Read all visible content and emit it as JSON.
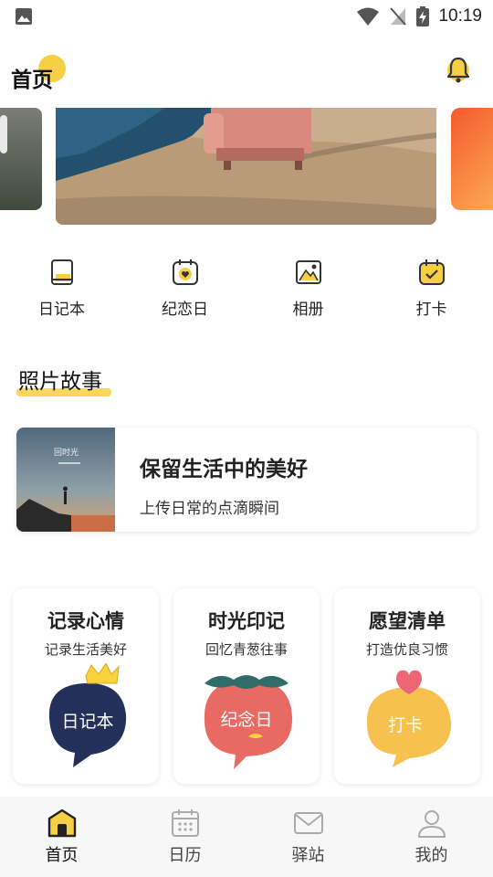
{
  "status_bar": {
    "time": "10:19"
  },
  "header": {
    "title": "首页"
  },
  "quick_actions": [
    {
      "label": "日记本",
      "icon": "diary-icon"
    },
    {
      "label": "纪恋日",
      "icon": "anniversary-icon"
    },
    {
      "label": "相册",
      "icon": "album-icon"
    },
    {
      "label": "打卡",
      "icon": "checkin-icon"
    }
  ],
  "section": {
    "title": "照片故事"
  },
  "story": {
    "thumb_title": "回时光",
    "title": "保留生活中的美好",
    "subtitle": "上传日常的点滴瞬间"
  },
  "cards": [
    {
      "title": "记录心情",
      "subtitle": "记录生活美好",
      "badge": "日记本"
    },
    {
      "title": "时光印记",
      "subtitle": "回忆青葱往事",
      "badge": "纪念日"
    },
    {
      "title": "愿望清单",
      "subtitle": "打造优良习惯",
      "badge": "打卡"
    }
  ],
  "tabs": [
    {
      "label": "首页",
      "icon": "home-icon",
      "active": true
    },
    {
      "label": "日历",
      "icon": "calendar-icon",
      "active": false
    },
    {
      "label": "驿站",
      "icon": "mail-icon",
      "active": false
    },
    {
      "label": "我的",
      "icon": "profile-icon",
      "active": false
    }
  ],
  "colors": {
    "accent": "#f7cf45",
    "ink": "#222222",
    "tab_bg": "#f7f7f7"
  }
}
